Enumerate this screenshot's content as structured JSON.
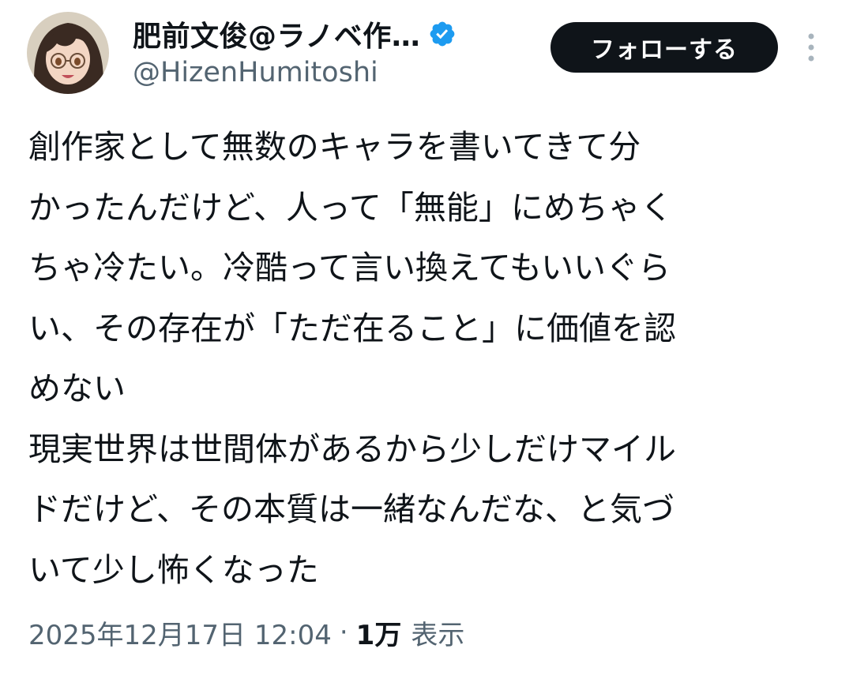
{
  "author": {
    "display_name": "肥前文俊@ラノベ作…",
    "handle": "@HizenHumitoshi",
    "verified": true,
    "avatar_icon": "avatar-image"
  },
  "actions": {
    "follow_label": "フォローする",
    "more_icon": "more-vertical-icon"
  },
  "tweet": {
    "lines": [
      "創作家として無数のキャラを書いてきて分",
      "かったんだけど、人って「無能」にめちゃく",
      "ちゃ冷たい。冷酷って言い換えてもいいぐら",
      "い、その存在が「ただ在ること」に価値を認",
      "めない",
      "現実世界は世間体があるから少しだけマイル",
      "ドだけど、その本質は一緒なんだな、と気づ",
      "いて少し怖くなった"
    ]
  },
  "meta": {
    "timestamp": "2025年12月17日 12:04",
    "separator": "·",
    "views_count": "1万",
    "views_label": "表示"
  },
  "colors": {
    "text_primary": "#0f1419",
    "text_secondary": "#536471",
    "verified_blue": "#1d9bf0",
    "button_bg": "#0f1419"
  }
}
